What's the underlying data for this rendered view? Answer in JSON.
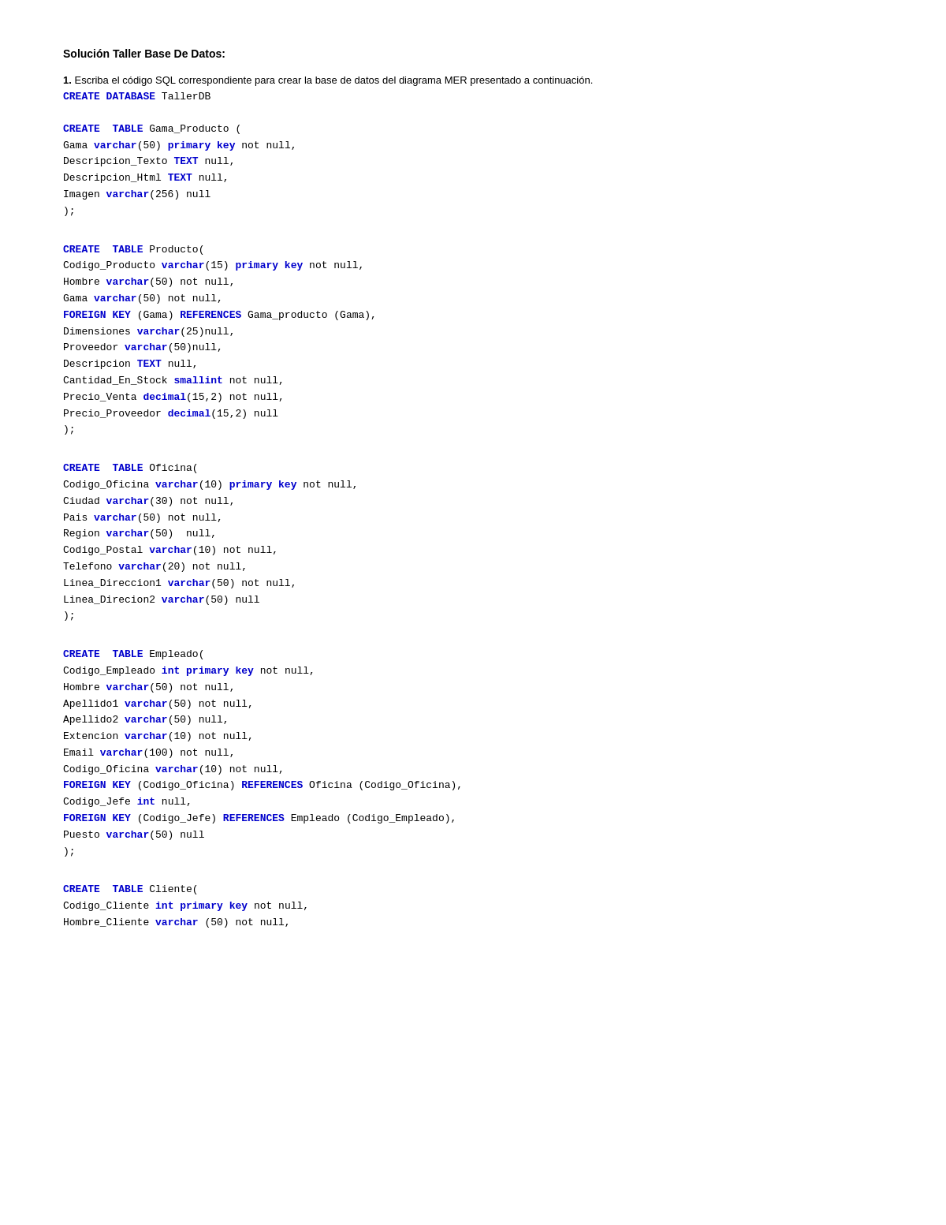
{
  "page": {
    "title": "Solución Taller Base De Datos:",
    "intro_number": "1.",
    "intro_text": " Escriba el código SQL correspondiente para crear la base de datos del diagrama MER presentado a continuación.",
    "create_db_line": "CREATE DATABASE TallerDB",
    "blocks": [
      {
        "id": "gama-producto",
        "lines": [
          {
            "parts": [
              {
                "text": "CREATE",
                "cls": "kw"
              },
              {
                "text": "  ",
                "cls": "black"
              },
              {
                "text": "TABLE",
                "cls": "kw"
              },
              {
                "text": " Gama_Producto (",
                "cls": "black"
              }
            ]
          },
          {
            "parts": [
              {
                "text": "Gama ",
                "cls": "black"
              },
              {
                "text": "varchar",
                "cls": "kw"
              },
              {
                "text": "(50) ",
                "cls": "black"
              },
              {
                "text": "primary key",
                "cls": "kw"
              },
              {
                "text": " not null,",
                "cls": "black"
              }
            ]
          },
          {
            "parts": [
              {
                "text": "Descripcion_Texto ",
                "cls": "black"
              },
              {
                "text": "TEXT",
                "cls": "kw"
              },
              {
                "text": " null,",
                "cls": "black"
              }
            ]
          },
          {
            "parts": [
              {
                "text": "Descripcion_Html ",
                "cls": "black"
              },
              {
                "text": "TEXT",
                "cls": "kw"
              },
              {
                "text": " null,",
                "cls": "black"
              }
            ]
          },
          {
            "parts": [
              {
                "text": "Imagen ",
                "cls": "black"
              },
              {
                "text": "varchar",
                "cls": "kw"
              },
              {
                "text": "(256) null",
                "cls": "black"
              }
            ]
          },
          {
            "parts": [
              {
                "text": ");",
                "cls": "black"
              }
            ]
          }
        ]
      },
      {
        "id": "producto",
        "lines": [
          {
            "parts": [
              {
                "text": "CREATE",
                "cls": "kw"
              },
              {
                "text": "  ",
                "cls": "black"
              },
              {
                "text": "TABLE",
                "cls": "kw"
              },
              {
                "text": " Producto(",
                "cls": "black"
              }
            ]
          },
          {
            "parts": [
              {
                "text": "Codigo_Producto ",
                "cls": "black"
              },
              {
                "text": "varchar",
                "cls": "kw"
              },
              {
                "text": "(15) ",
                "cls": "black"
              },
              {
                "text": "primary key",
                "cls": "kw"
              },
              {
                "text": " not null,",
                "cls": "black"
              }
            ]
          },
          {
            "parts": [
              {
                "text": "Hombre ",
                "cls": "black"
              },
              {
                "text": "varchar",
                "cls": "kw"
              },
              {
                "text": "(50) not null,",
                "cls": "black"
              }
            ]
          },
          {
            "parts": [
              {
                "text": "Gama ",
                "cls": "black"
              },
              {
                "text": "varchar",
                "cls": "kw"
              },
              {
                "text": "(50) not null,",
                "cls": "black"
              }
            ]
          },
          {
            "parts": [
              {
                "text": "FOREIGN KEY",
                "cls": "kw"
              },
              {
                "text": " (Gama) ",
                "cls": "black"
              },
              {
                "text": "REFERENCES",
                "cls": "kw"
              },
              {
                "text": " Gama_producto (Gama),",
                "cls": "black"
              }
            ]
          },
          {
            "parts": [
              {
                "text": "Dimensiones ",
                "cls": "black"
              },
              {
                "text": "varchar",
                "cls": "kw"
              },
              {
                "text": "(25)null,",
                "cls": "black"
              }
            ]
          },
          {
            "parts": [
              {
                "text": "Proveedor ",
                "cls": "black"
              },
              {
                "text": "varchar",
                "cls": "kw"
              },
              {
                "text": "(50)null,",
                "cls": "black"
              }
            ]
          },
          {
            "parts": [
              {
                "text": "Descripcion ",
                "cls": "black"
              },
              {
                "text": "TEXT",
                "cls": "kw"
              },
              {
                "text": " null,",
                "cls": "black"
              }
            ]
          },
          {
            "parts": [
              {
                "text": "Cantidad_En_Stock ",
                "cls": "black"
              },
              {
                "text": "smallint",
                "cls": "kw"
              },
              {
                "text": " not null,",
                "cls": "black"
              }
            ]
          },
          {
            "parts": [
              {
                "text": "Precio_Venta ",
                "cls": "black"
              },
              {
                "text": "decimal",
                "cls": "kw"
              },
              {
                "text": "(15,2) not null,",
                "cls": "black"
              }
            ]
          },
          {
            "parts": [
              {
                "text": "Precio_Proveedor ",
                "cls": "black"
              },
              {
                "text": "decimal",
                "cls": "kw"
              },
              {
                "text": "(15,2) null",
                "cls": "black"
              }
            ]
          },
          {
            "parts": [
              {
                "text": ");",
                "cls": "black"
              }
            ]
          }
        ]
      },
      {
        "id": "oficina",
        "lines": [
          {
            "parts": [
              {
                "text": "CREATE",
                "cls": "kw"
              },
              {
                "text": "  ",
                "cls": "black"
              },
              {
                "text": "TABLE",
                "cls": "kw"
              },
              {
                "text": " Oficina(",
                "cls": "black"
              }
            ]
          },
          {
            "parts": [
              {
                "text": "Codigo_Oficina ",
                "cls": "black"
              },
              {
                "text": "varchar",
                "cls": "kw"
              },
              {
                "text": "(10) ",
                "cls": "black"
              },
              {
                "text": "primary key",
                "cls": "kw"
              },
              {
                "text": " not null,",
                "cls": "black"
              }
            ]
          },
          {
            "parts": [
              {
                "text": "Ciudad ",
                "cls": "black"
              },
              {
                "text": "varchar",
                "cls": "kw"
              },
              {
                "text": "(30) not null,",
                "cls": "black"
              }
            ]
          },
          {
            "parts": [
              {
                "text": "Pais ",
                "cls": "black"
              },
              {
                "text": "varchar",
                "cls": "kw"
              },
              {
                "text": "(50) not null,",
                "cls": "black"
              }
            ]
          },
          {
            "parts": [
              {
                "text": "Region ",
                "cls": "black"
              },
              {
                "text": "varchar",
                "cls": "kw"
              },
              {
                "text": "(50)  null,",
                "cls": "black"
              }
            ]
          },
          {
            "parts": [
              {
                "text": "Codigo_Postal ",
                "cls": "black"
              },
              {
                "text": "varchar",
                "cls": "kw"
              },
              {
                "text": "(10) not null,",
                "cls": "black"
              }
            ]
          },
          {
            "parts": [
              {
                "text": "Telefono ",
                "cls": "black"
              },
              {
                "text": "varchar",
                "cls": "kw"
              },
              {
                "text": "(20) not null,",
                "cls": "black"
              }
            ]
          },
          {
            "parts": [
              {
                "text": "Linea_Direccion1 ",
                "cls": "black"
              },
              {
                "text": "varchar",
                "cls": "kw"
              },
              {
                "text": "(50) not null,",
                "cls": "black"
              }
            ]
          },
          {
            "parts": [
              {
                "text": "Linea_Direcion2 ",
                "cls": "black"
              },
              {
                "text": "varchar",
                "cls": "kw"
              },
              {
                "text": "(50) null",
                "cls": "black"
              }
            ]
          },
          {
            "parts": [
              {
                "text": ");",
                "cls": "black"
              }
            ]
          }
        ]
      },
      {
        "id": "empleado",
        "lines": [
          {
            "parts": [
              {
                "text": "CREATE",
                "cls": "kw"
              },
              {
                "text": "  ",
                "cls": "black"
              },
              {
                "text": "TABLE",
                "cls": "kw"
              },
              {
                "text": " Empleado(",
                "cls": "black"
              }
            ]
          },
          {
            "parts": [
              {
                "text": "Codigo_Empleado ",
                "cls": "black"
              },
              {
                "text": "int",
                "cls": "kw"
              },
              {
                "text": " ",
                "cls": "black"
              },
              {
                "text": "primary key",
                "cls": "kw"
              },
              {
                "text": " not null,",
                "cls": "black"
              }
            ]
          },
          {
            "parts": [
              {
                "text": "Hombre ",
                "cls": "black"
              },
              {
                "text": "varchar",
                "cls": "kw"
              },
              {
                "text": "(50) not null,",
                "cls": "black"
              }
            ]
          },
          {
            "parts": [
              {
                "text": "Apellido1 ",
                "cls": "black"
              },
              {
                "text": "varchar",
                "cls": "kw"
              },
              {
                "text": "(50) not null,",
                "cls": "black"
              }
            ]
          },
          {
            "parts": [
              {
                "text": "Apellido2 ",
                "cls": "black"
              },
              {
                "text": "varchar",
                "cls": "kw"
              },
              {
                "text": "(50) null,",
                "cls": "black"
              }
            ]
          },
          {
            "parts": [
              {
                "text": "Extencion ",
                "cls": "black"
              },
              {
                "text": "varchar",
                "cls": "kw"
              },
              {
                "text": "(10) not null,",
                "cls": "black"
              }
            ]
          },
          {
            "parts": [
              {
                "text": "Email ",
                "cls": "black"
              },
              {
                "text": "varchar",
                "cls": "kw"
              },
              {
                "text": "(100) not null,",
                "cls": "black"
              }
            ]
          },
          {
            "parts": [
              {
                "text": "Codigo_Oficina ",
                "cls": "black"
              },
              {
                "text": "varchar",
                "cls": "kw"
              },
              {
                "text": "(10) not null,",
                "cls": "black"
              }
            ]
          },
          {
            "parts": [
              {
                "text": "FOREIGN KEY",
                "cls": "kw"
              },
              {
                "text": " (Codigo_Oficina) ",
                "cls": "black"
              },
              {
                "text": "REFERENCES",
                "cls": "kw"
              },
              {
                "text": " Oficina (Codigo_Oficina),",
                "cls": "black"
              }
            ]
          },
          {
            "parts": [
              {
                "text": "Codigo_Jefe ",
                "cls": "black"
              },
              {
                "text": "int",
                "cls": "kw"
              },
              {
                "text": " null,",
                "cls": "black"
              }
            ]
          },
          {
            "parts": [
              {
                "text": "FOREIGN KEY",
                "cls": "kw"
              },
              {
                "text": " (Codigo_Jefe) ",
                "cls": "black"
              },
              {
                "text": "REFERENCES",
                "cls": "kw"
              },
              {
                "text": " Empleado (Codigo_Empleado),",
                "cls": "black"
              }
            ]
          },
          {
            "parts": [
              {
                "text": "Puesto ",
                "cls": "black"
              },
              {
                "text": "varchar",
                "cls": "kw"
              },
              {
                "text": "(50) null",
                "cls": "black"
              }
            ]
          },
          {
            "parts": [
              {
                "text": ");",
                "cls": "black"
              }
            ]
          }
        ]
      },
      {
        "id": "cliente",
        "lines": [
          {
            "parts": [
              {
                "text": "CREATE",
                "cls": "kw"
              },
              {
                "text": "  ",
                "cls": "black"
              },
              {
                "text": "TABLE",
                "cls": "kw"
              },
              {
                "text": " Cliente(",
                "cls": "black"
              }
            ]
          },
          {
            "parts": [
              {
                "text": "Codigo_Cliente ",
                "cls": "black"
              },
              {
                "text": "int",
                "cls": "kw"
              },
              {
                "text": " ",
                "cls": "black"
              },
              {
                "text": "primary key",
                "cls": "kw"
              },
              {
                "text": " not null,",
                "cls": "black"
              }
            ]
          },
          {
            "parts": [
              {
                "text": "Hombre_Cliente ",
                "cls": "black"
              },
              {
                "text": "varchar",
                "cls": "kw"
              },
              {
                "text": " (50) not null,",
                "cls": "black"
              }
            ]
          }
        ]
      }
    ]
  }
}
